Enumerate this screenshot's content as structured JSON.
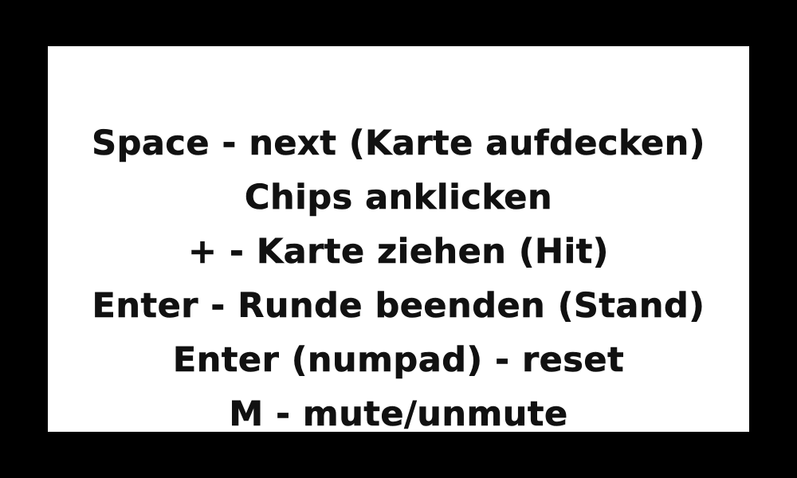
{
  "colors": {
    "background": "#000000",
    "panel": "#ffffff",
    "text": "#111111"
  },
  "instructions": [
    "Space - next (Karte aufdecken)",
    "Chips anklicken",
    "+ - Karte ziehen (Hit)",
    "Enter - Runde beenden (Stand)",
    "Enter (numpad) - reset",
    "M - mute/unmute"
  ]
}
